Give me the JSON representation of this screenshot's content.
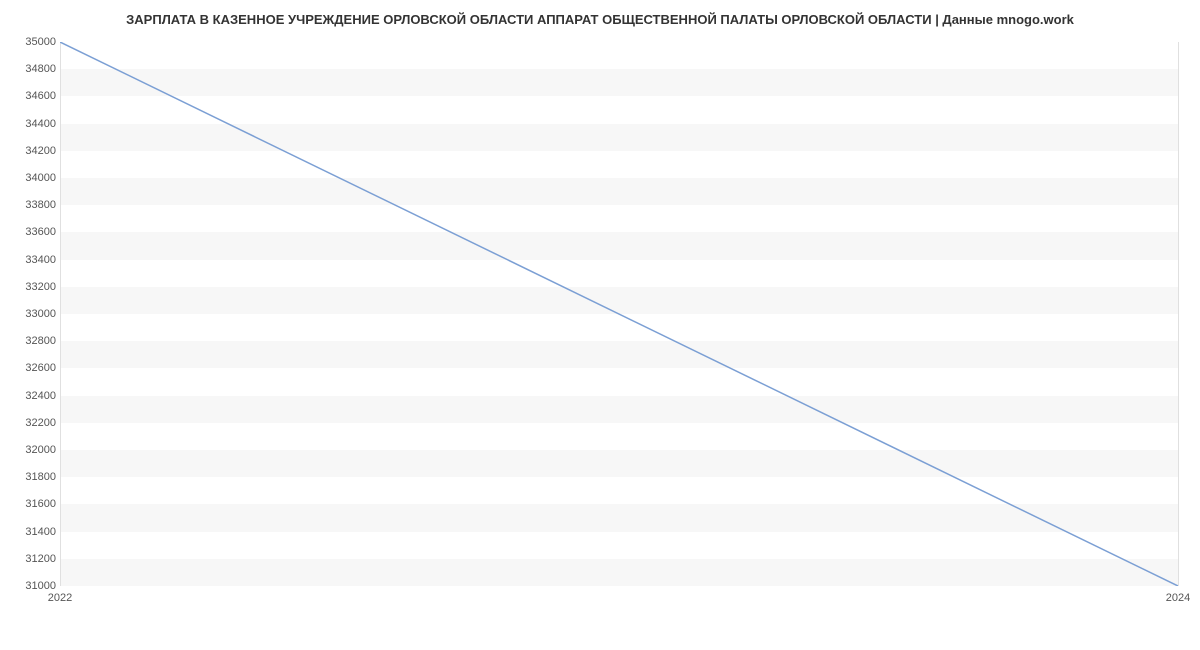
{
  "chart_data": {
    "type": "line",
    "title": "ЗАРПЛАТА В КАЗЕННОЕ УЧРЕЖДЕНИЕ  ОРЛОВСКОЙ ОБЛАСТИ АППАРАТ ОБЩЕСТВЕННОЙ ПАЛАТЫ ОРЛОВСКОЙ ОБЛАСТИ | Данные mnogo.work",
    "x": [
      2022,
      2024
    ],
    "y": [
      35000,
      31000
    ],
    "xlabel": "",
    "ylabel": "",
    "xlim": [
      2022,
      2024
    ],
    "ylim": [
      31000,
      35000
    ],
    "yticks": [
      31000,
      31200,
      31400,
      31600,
      31800,
      32000,
      32200,
      32400,
      32600,
      32800,
      33000,
      33200,
      33400,
      33600,
      33800,
      34000,
      34200,
      34400,
      34600,
      34800,
      35000
    ],
    "xticks": [
      2022,
      2024
    ],
    "line_color": "#7b9fd4"
  }
}
